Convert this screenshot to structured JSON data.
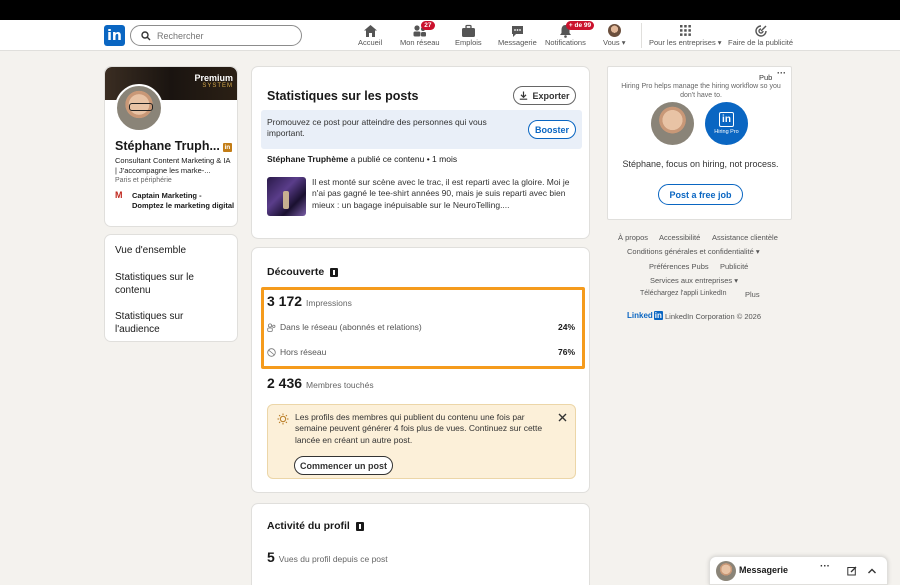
{
  "nav": {
    "search_placeholder": "Rechercher",
    "items": [
      {
        "label": "Accueil"
      },
      {
        "label": "Mon réseau",
        "badge": "27"
      },
      {
        "label": "Emplois"
      },
      {
        "label": "Messagerie"
      },
      {
        "label": "Notifications",
        "badge": "+ de 99"
      },
      {
        "label": "Vous"
      },
      {
        "label": "Pour les entreprises"
      },
      {
        "label": "Faire de la publicité"
      }
    ]
  },
  "profile": {
    "banner_title": "Premium",
    "banner_sub": "SYSTEM",
    "name": "Stéphane Truph...",
    "headline": "Consultant Content Marketing & IA | J'accompagne les marke-...",
    "location": "Paris et périphérie",
    "company": "Captain Marketing - Domptez le marketing digital"
  },
  "sidenav": [
    "Vue d'ensemble",
    "Statistiques sur le contenu",
    "Statistiques sur l'audience"
  ],
  "stats": {
    "title": "Statistiques sur les posts",
    "export_label": "Exporter",
    "promo_text": "Promouvez ce post pour atteindre des personnes qui vous important.",
    "boost_label": "Booster",
    "author": "Stéphane Truphème",
    "posted_text": "a publié ce contenu • 1 mois",
    "post_text": "Il est monté sur scène avec le trac, il est reparti avec la gloire. Moi je n'ai pas gagné le tee-shirt années 90, mais je suis reparti avec bien mieux : un bagage inépuisable sur le NeuroTelling...."
  },
  "discovery": {
    "title": "Découverte",
    "impressions": "3 172",
    "impressions_label": "Impressions",
    "network_label": "Dans le réseau (abonnés et relations)",
    "network_pct": "24%",
    "outside_label": "Hors réseau",
    "outside_pct": "76%",
    "members": "2 436",
    "members_label": "Membres touchés",
    "tip_text": "Les profils des membres qui publient du contenu une fois par semaine peuvent générer 4 fois plus de vues. Continuez sur cette lancée en créant un autre post.",
    "tip_button": "Commencer un post"
  },
  "activity": {
    "title": "Activité du profil",
    "views": "5",
    "views_label": "Vues du profil depuis ce post"
  },
  "ad": {
    "label": "Pub",
    "text": "Hiring Pro helps manage the hiring workflow so you don't have to.",
    "logo_text": "Hiring Pro",
    "headline": "Stéphane, focus on hiring, not process.",
    "cta": "Post a free job"
  },
  "footer": {
    "links_row1": [
      "À propos",
      "Accessibilité",
      "Assistance clientèle"
    ],
    "links_row2": [
      "Conditions générales et confidentialité"
    ],
    "links_row3": [
      "Préférences Pubs",
      "Publicité"
    ],
    "links_row4": [
      "Services aux entreprises"
    ],
    "links_row5": [
      "Téléchargez l'appli LinkedIn",
      "Plus"
    ],
    "brand": "Linked",
    "copyright": "LinkedIn Corporation © 2026"
  },
  "messaging": {
    "label": "Messagerie"
  },
  "colors": {
    "brand": "#0a66c2",
    "highlight": "#f59b1c",
    "badge": "#cb112d"
  }
}
